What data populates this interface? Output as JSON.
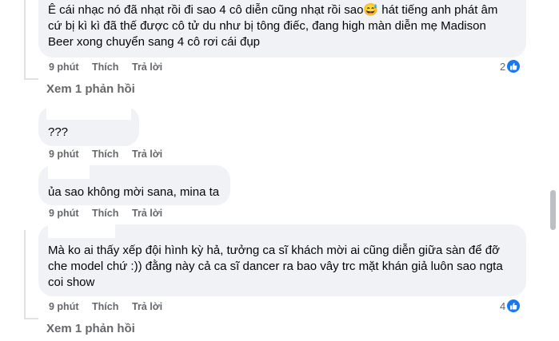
{
  "comments": [
    {
      "text_lines": [
        "Ê cái nhạc nó đã nhạt rồi đi sao 4 cô diễn cũng nhạt rồi sao😅 hát tiếng anh phát âm",
        "cứ bị kì kì đã thế được cô tử du như bị tông điếc, đang high màn diễn mẹ Madison",
        "Beer xong chuyển sang 4 cô rơi cái đụp"
      ],
      "time": "9 phút",
      "like": "Thích",
      "reply": "Trả lời",
      "reaction_count": "2",
      "see_replies": "Xem 1 phản hồi"
    },
    {
      "text_lines": [
        "???"
      ],
      "time": "9 phút",
      "like": "Thích",
      "reply": "Trả lời"
    },
    {
      "text_lines": [
        "ủa sao không mời sana, mina ta"
      ],
      "time": "9 phút",
      "like": "Thích",
      "reply": "Trả lời"
    },
    {
      "text_lines": [
        "Mà ko ai thấy xếp đội hình kỳ hả, tưởng ca sĩ khách mời ai cũng diễn giữa sàn để đỡ",
        "che model chứ :)) đằng này cả ca sĩ dancer ra bao vây trc mặt khán giả luôn sao ngta",
        "coi show"
      ],
      "time": "9 phút",
      "like": "Thích",
      "reply": "Trả lời",
      "reaction_count": "4",
      "see_replies": "Xem 1 phản hồi"
    }
  ],
  "colors": {
    "bubble": "#f0f2f5",
    "meta": "#65676b",
    "like_blue": "#1877f2"
  }
}
